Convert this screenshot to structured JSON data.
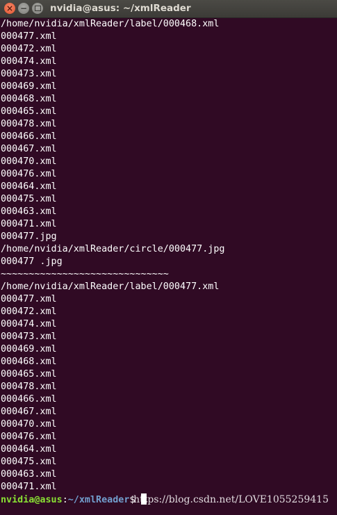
{
  "window": {
    "title": "nvidia@asus: ~/xmlReader",
    "close_symbol": "×",
    "minimize_symbol": "−"
  },
  "terminal": {
    "lines": [
      "/home/nvidia/xmlReader/label/000468.xml",
      "000477.xml",
      "000472.xml",
      "000474.xml",
      "000473.xml",
      "000469.xml",
      "000468.xml",
      "000465.xml",
      "000478.xml",
      "000466.xml",
      "000467.xml",
      "000470.xml",
      "000476.xml",
      "000464.xml",
      "000475.xml",
      "000463.xml",
      "000471.xml",
      "000477.jpg",
      "/home/nvidia/xmlReader/circle/000477.jpg",
      "000477 .jpg",
      "~~~~~~~~~~~~~~~~~~~~~~~~~~~~~~",
      "/home/nvidia/xmlReader/label/000477.xml",
      "000477.xml",
      "000472.xml",
      "000474.xml",
      "000473.xml",
      "000469.xml",
      "000468.xml",
      "000465.xml",
      "000478.xml",
      "000466.xml",
      "000467.xml",
      "000470.xml",
      "000476.xml",
      "000464.xml",
      "000475.xml",
      "000463.xml",
      "000471.xml"
    ],
    "prompt": {
      "user_host": "nvidia@asus",
      "separator": ":",
      "path": "~/xmlReader",
      "symbol": "$ "
    },
    "colors": {
      "background": "#300a24",
      "text": "#ffffff",
      "prompt_user": "#8ae234",
      "prompt_path": "#729fcf"
    }
  },
  "watermark": "https://blog.csdn.net/LOVE1055259415"
}
